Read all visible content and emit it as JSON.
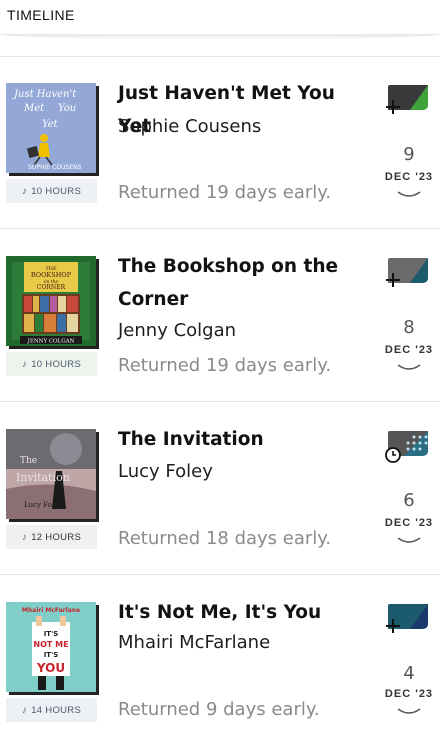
{
  "header": {
    "title": "TIMELINE"
  },
  "entries": [
    {
      "title": "Just Haven't Met You Yet",
      "author": "Sophie Cousens",
      "status": "Returned 19 days early.",
      "duration": "10 HOURS",
      "day": "9",
      "month": "DEC '23",
      "cover_text": {
        "line1": "Just Haven't",
        "line2": "Met",
        "line3": "You",
        "line4": "Yet",
        "author": "SOPHIE COUSENS"
      },
      "format_icon": "audiobook-icon"
    },
    {
      "title": "The Bookshop on the Corner",
      "author": "Jenny Colgan",
      "status": "Returned 19 days early.",
      "duration": "10 HOURS",
      "day": "8",
      "month": "DEC '23",
      "cover_text": {
        "line1": "THE",
        "line2": "BOOKSHOP",
        "line3": "on the",
        "line4": "CORNER",
        "author": "JENNY COLGAN"
      },
      "format_icon": "audiobook-icon"
    },
    {
      "title": "The Invitation",
      "author": "Lucy Foley",
      "status": "Returned 18 days early.",
      "duration": "12 HOURS",
      "day": "6",
      "month": "DEC '23",
      "cover_text": {
        "line1": "The",
        "line2": "Invitation",
        "author": "Lucy Foley"
      },
      "format_icon": "audiobook-timer-icon"
    },
    {
      "title": "It's Not Me, It's You",
      "author": "Mhairi McFarlane",
      "status": "Returned 9 days early.",
      "duration": "14 HOURS",
      "day": "4",
      "month": "DEC '23",
      "cover_text": {
        "author": "Mhairi McFarlane",
        "line1": "IT'S",
        "line2": "NOT ME",
        "line3": "IT'S",
        "line4": "YOU"
      },
      "format_icon": "audiobook-icon"
    }
  ],
  "colors": {
    "green_accent": "#3fa33a",
    "grey_dark": "#3a3a3a",
    "teal": "#1c5a6e",
    "navy": "#1c3a6e"
  }
}
